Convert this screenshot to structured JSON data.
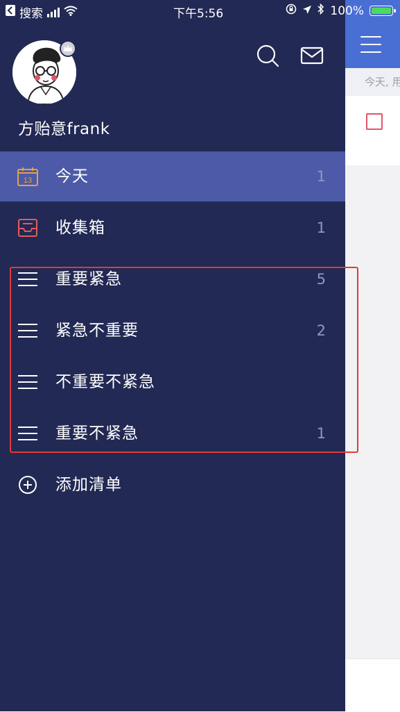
{
  "status_bar": {
    "back_label": "搜索",
    "time": "下午5:56",
    "battery": "100%"
  },
  "profile": {
    "name": "方贻意frank"
  },
  "menu": {
    "items": [
      {
        "label": "今天",
        "count": "1",
        "icon": "calendar-icon"
      },
      {
        "label": "收集箱",
        "count": "1",
        "icon": "inbox-icon"
      },
      {
        "label": "重要紧急",
        "count": "5",
        "icon": "list-icon"
      },
      {
        "label": "紧急不重要",
        "count": "2",
        "icon": "list-icon"
      },
      {
        "label": "不重要不紧急",
        "count": "",
        "icon": "list-icon"
      },
      {
        "label": "重要不紧急",
        "count": "1",
        "icon": "list-icon"
      },
      {
        "label": "添加清单",
        "icon": "add-circle-icon"
      }
    ]
  },
  "calendar_day": "13",
  "background_app": {
    "subheader": "今天, 用"
  },
  "colors": {
    "drawer_bg": "#222954",
    "active_bg": "#4c5aa8",
    "accent": "#4a6fd4",
    "highlight_box": "#e03a3a",
    "inbox_red": "#e35b5b",
    "calendar_orange": "#e0a24a"
  }
}
